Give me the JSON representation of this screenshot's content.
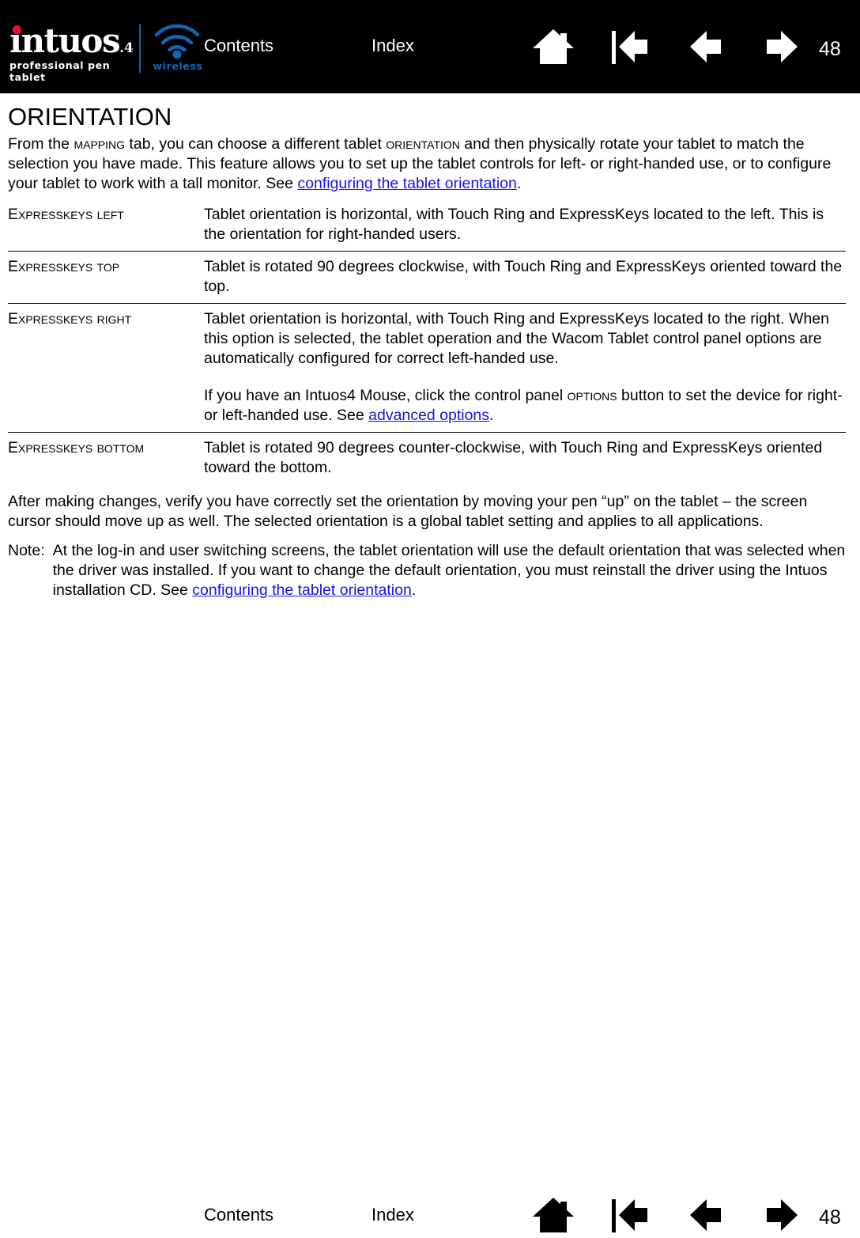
{
  "colors": {
    "header_bg": "#000000",
    "page_bg": "#ffffff",
    "logo_dot_red": "#e8112d",
    "wireless_blue": "#0f66b5",
    "link_blue": "#1414e6",
    "text": "#000000"
  },
  "header": {
    "logo": {
      "wordmark": "intuos",
      "version": ".4",
      "tagline": "professional pen tablet",
      "wireless_label": "wireless"
    },
    "contents_label": "Contents",
    "index_label": "Index",
    "page_number": "48",
    "icons": [
      "home-icon",
      "go-to-first-page-icon",
      "previous-page-icon",
      "next-page-icon"
    ]
  },
  "main": {
    "title": "ORIENTATION",
    "intro": {
      "part1": "From the ",
      "sc1": "Mapping",
      "part2": " tab, you can choose a different tablet ",
      "sc2": "Orientation",
      "part3": " and then physically rotate your tablet to match the selection you have made.  This feature allows you to set up the tablet controls for left- or right-handed use, or to configure your tablet to work with a tall monitor.  See ",
      "link": "configuring the tablet orientation",
      "part4": "."
    },
    "table": {
      "rows": [
        {
          "label_a": "Express",
          "label_b": "Keys ",
          "label_c": "Left",
          "desc": "Tablet orientation is horizontal, with Touch Ring and ExpressKeys located to the left.  This is the orientation for right-handed users."
        },
        {
          "label_a": "Express",
          "label_b": "Keys ",
          "label_c": "Top",
          "desc": "Tablet is rotated 90 degrees clockwise, with Touch Ring and ExpressKeys oriented toward the top."
        },
        {
          "label_a": "Express",
          "label_b": "Keys ",
          "label_c": "Right",
          "desc": "Tablet orientation is horizontal, with Touch Ring and ExpressKeys located to the right.  When this option is selected, the tablet operation and the Wacom Tablet control panel options are automatically configured for correct left-handed use.",
          "desc2_part1": "If you have an Intuos4 Mouse, click the control panel ",
          "desc2_sc": "Options",
          "desc2_part2": " button to set the device for right- or left-handed use.  See ",
          "desc2_link": "advanced options",
          "desc2_part3": "."
        },
        {
          "label_a": "Express",
          "label_b": "Keys ",
          "label_c": "Bottom",
          "desc": "Tablet is rotated 90 degrees counter-clockwise, with Touch Ring and ExpressKeys oriented toward the bottom."
        }
      ]
    },
    "after_table": "After making changes, verify you have correctly set the orientation by moving your pen “up” on the tablet – the screen cursor should move up as well.  The selected orientation is a global tablet setting and applies to all applications.",
    "note": {
      "label": "Note:",
      "part1": "At the log-in and user switching screens, the tablet orientation will use the default orientation that was selected when the driver was installed.  If you want to change the default orientation, you must reinstall the driver using the Intuos installation CD.  See ",
      "link": "configuring the tablet orientation",
      "part2": "."
    }
  },
  "footer": {
    "contents_label": "Contents",
    "index_label": "Index",
    "page_number": "48",
    "icons": [
      "home-icon",
      "go-to-first-page-icon",
      "previous-page-icon",
      "next-page-icon"
    ]
  }
}
